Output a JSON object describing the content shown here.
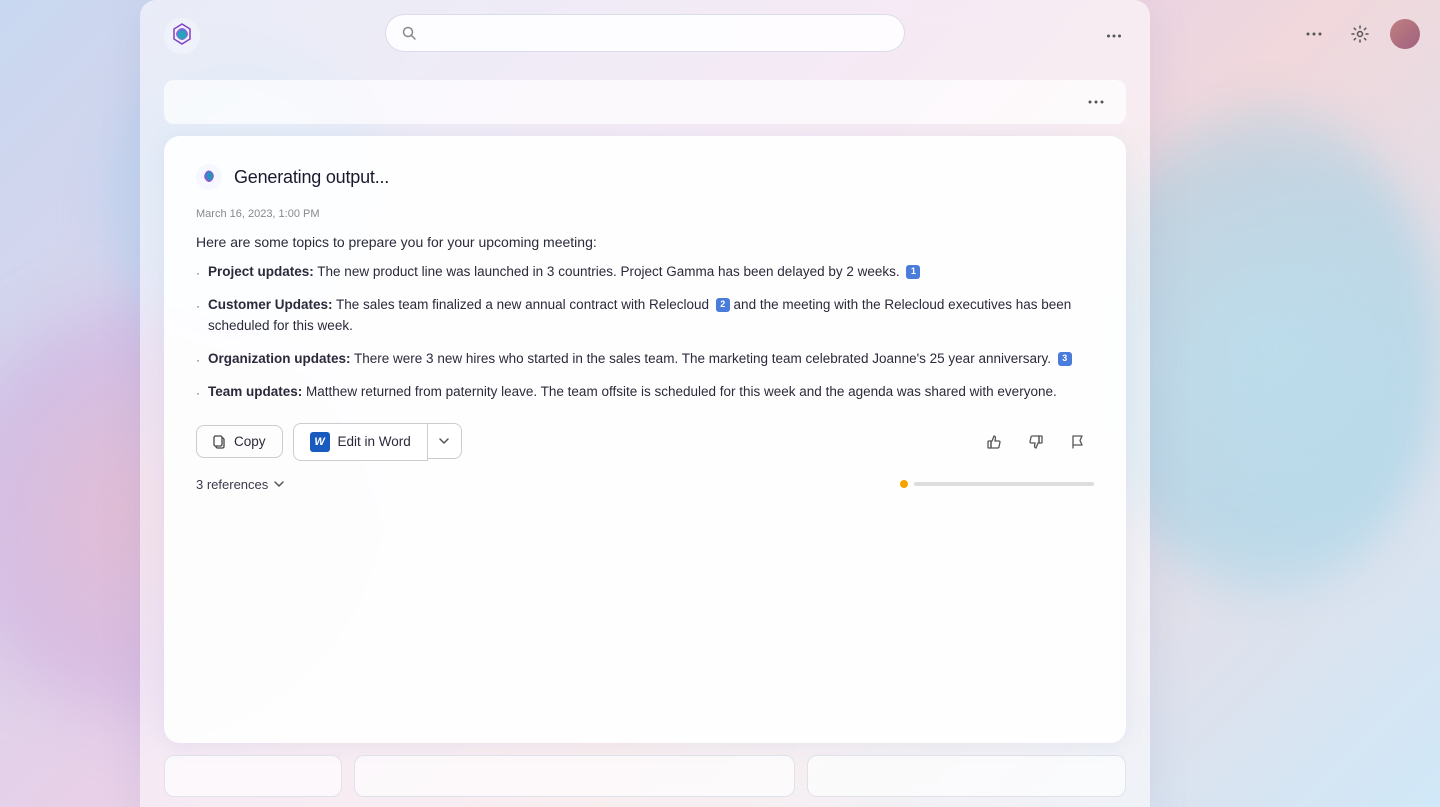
{
  "background": {
    "color": "#dde8f5"
  },
  "global_controls": {
    "more_options_label": "...",
    "settings_label": "settings"
  },
  "search": {
    "placeholder": ""
  },
  "panel_header": {
    "text": ""
  },
  "generating": {
    "title": "Generating output...",
    "timestamp": "March 16, 2023, 1:00 PM",
    "intro": "Here are some topics to prepare you for your upcoming meeting:",
    "bullets": [
      {
        "label": "Project updates:",
        "text": " The new product line was launched in 3 countries. Project Gamma has been delayed by 2 weeks.",
        "ref": "1"
      },
      {
        "label": "Customer Updates:",
        "text": " The sales team finalized a new annual contract with Relecloud",
        "ref": "2",
        "text2": " and the meeting with the Relecloud executives has been scheduled for this week."
      },
      {
        "label": "Organization updates:",
        "text": " There were 3 new hires who started in the sales team. The marketing team celebrated Joanne's 25 year anniversary.",
        "ref": "3"
      },
      {
        "label": "Team updates:",
        "text": " Matthew returned from paternity leave. The team offsite is scheduled for this week and the agenda was shared with everyone."
      }
    ]
  },
  "actions": {
    "copy_label": "Copy",
    "edit_word_label": "Edit in Word",
    "references_label": "3 references"
  },
  "feedback": {
    "thumbs_up": "👍",
    "thumbs_down": "👎",
    "flag": "⚑"
  },
  "suggestions": [
    {
      "label": ""
    },
    {
      "label": ""
    },
    {
      "label": ""
    }
  ]
}
